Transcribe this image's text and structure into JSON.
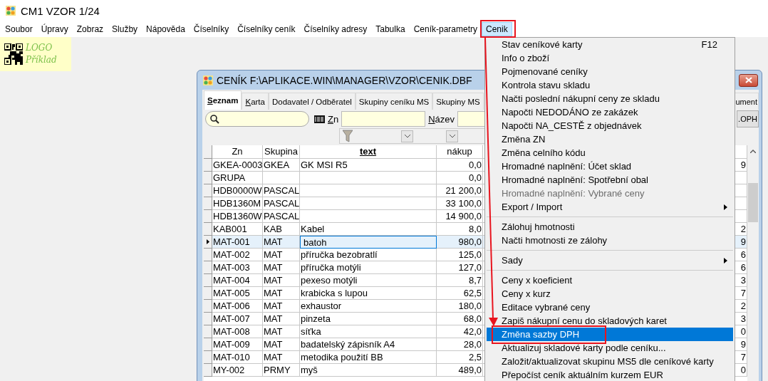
{
  "window": {
    "title": "CM1 VZOR 1/24"
  },
  "menubar": [
    {
      "label": "Soubor",
      "selected": false
    },
    {
      "label": "Úpravy",
      "selected": false
    },
    {
      "label": "Zobraz",
      "selected": false
    },
    {
      "label": "Služby",
      "selected": false
    },
    {
      "label": "Nápověda",
      "selected": false
    },
    {
      "label": "Číselníky",
      "selected": false
    },
    {
      "label": "Číselníky ceník",
      "selected": false
    },
    {
      "label": "Číselníky adresy",
      "selected": false
    },
    {
      "label": "Tabulka",
      "selected": false
    },
    {
      "label": "Ceník-parametry",
      "selected": false
    },
    {
      "label": "Cenik",
      "selected": true
    }
  ],
  "logo": {
    "line_1": "LOGO",
    "line_2": "Příklad"
  },
  "child_window": {
    "title": "CENÍK F:\\APLIKACE.WIN\\MANAGER\\VZOR\\CENIK.DBF",
    "tabs": [
      {
        "label": "Seznam",
        "selected": true,
        "mnemonic": true
      },
      {
        "label": "Karta",
        "selected": false,
        "mnemonic": true
      },
      {
        "label": "Dodavatel / Odběratel",
        "selected": false,
        "mnemonic": false
      },
      {
        "label": "Skupiny ceníku MS",
        "selected": false,
        "mnemonic": false
      },
      {
        "label": "Skupiny MS",
        "selected": false,
        "mnemonic": false
      },
      {
        "label": "ument",
        "selected": false,
        "mnemonic": false
      }
    ],
    "filters": [
      {
        "label": "Zn"
      },
      {
        "label": "Název"
      }
    ],
    "button": ".OPH",
    "table": {
      "columns": [
        {
          "label": "Zn",
          "sorted": false
        },
        {
          "label": "Skupina",
          "sorted": false
        },
        {
          "label": "text",
          "sorted": true
        },
        {
          "label": "nákup",
          "sorted": false
        }
      ],
      "rows": [
        {
          "zn": "GKEA-0003",
          "skupina": "GKEA",
          "text": "GK MSI R5",
          "nakup": "0,0",
          "column_5": "9",
          "selected": false
        },
        {
          "zn": "GRUPA",
          "nakup": "0,0",
          "selected": false
        },
        {
          "zn": "HDB0000W",
          "skupina": "PASCAL",
          "nakup": "21 200,0",
          "selected": false
        },
        {
          "zn": "HDB1360M",
          "skupina": "PASCAL",
          "nakup": "33 100,0",
          "selected": false
        },
        {
          "zn": "HDB1360W",
          "skupina": "PASCAL",
          "nakup": "14 900,0",
          "selected": false
        },
        {
          "zn": "KAB001",
          "skupina": "KAB",
          "text": "Kabel",
          "nakup": "8,0",
          "column_5": "2",
          "selected": false
        },
        {
          "zn": "MAT-001",
          "skupina": "MAT",
          "text": "batoh",
          "nakup": "980,0",
          "column_5": "9",
          "selected": true
        },
        {
          "zn": "MAT-002",
          "skupina": "MAT",
          "text": "příručka bezobratlí",
          "nakup": "125,0",
          "column_5": "6",
          "selected": false
        },
        {
          "zn": "MAT-003",
          "skupina": "MAT",
          "text": "příručka motýli",
          "nakup": "127,0",
          "column_5": "6",
          "selected": false
        },
        {
          "zn": "MAT-004",
          "skupina": "MAT",
          "text": "pexeso motýli",
          "nakup": "8,7",
          "column_5": "3",
          "selected": false
        },
        {
          "zn": "MAT-005",
          "skupina": "MAT",
          "text": "krabicka s lupou",
          "nakup": "62,5",
          "column_5": "7",
          "selected": false
        },
        {
          "zn": "MAT-006",
          "skupina": "MAT",
          "text": "exhaustor",
          "nakup": "180,0",
          "column_5": "2",
          "selected": false
        },
        {
          "zn": "MAT-007",
          "skupina": "MAT",
          "text": "pinzeta",
          "nakup": "68,0",
          "column_5": "3",
          "selected": false
        },
        {
          "zn": "MAT-008",
          "skupina": "MAT",
          "text": "síťka",
          "nakup": "42,0",
          "column_5": "0",
          "selected": false
        },
        {
          "zn": "MAT-009",
          "skupina": "MAT",
          "text": "badatelský zápisník A4",
          "nakup": "28,0",
          "column_5": "9",
          "selected": false
        },
        {
          "zn": "MAT-010",
          "skupina": "MAT",
          "text": "metodika použití BB",
          "nakup": "2,5",
          "column_5": "7",
          "selected": false
        },
        {
          "zn": "MY-002",
          "skupina": "PRMY",
          "text": "myš",
          "nakup": "489,0",
          "column_5": "0",
          "selected": false
        }
      ]
    }
  },
  "menu": {
    "items": [
      {
        "kind": "item",
        "label": "Stav ceníkové karty",
        "shortcut": "F12",
        "disabled": false,
        "selected": false
      },
      {
        "kind": "item",
        "label": "Info o zboží",
        "disabled": false,
        "selected": false
      },
      {
        "kind": "item",
        "label": "Pojmenované ceníky",
        "disabled": false,
        "selected": false
      },
      {
        "kind": "item",
        "label": "Kontrola stavu skladu",
        "disabled": false,
        "selected": false
      },
      {
        "kind": "item",
        "label": "Načti poslední nákupní ceny ze skladu",
        "disabled": false,
        "selected": false
      },
      {
        "kind": "item",
        "label": "Napočti NEDODÁNO ze zakázek",
        "disabled": false,
        "selected": false
      },
      {
        "kind": "item",
        "label": "Napočti NA_CESTĚ z objednávek",
        "disabled": false,
        "selected": false
      },
      {
        "kind": "item",
        "label": "Změna ZN",
        "disabled": false,
        "selected": false
      },
      {
        "kind": "item",
        "label": "Změna celního kódu",
        "disabled": false,
        "selected": false
      },
      {
        "kind": "item",
        "label": "Hromadné naplnění: Účet sklad",
        "disabled": false,
        "selected": false
      },
      {
        "kind": "item",
        "label": "Hromadné naplnění: Spotřební obal",
        "disabled": false,
        "selected": false
      },
      {
        "kind": "item",
        "label": "Hromadné naplnění: Vybrané ceny",
        "disabled": true,
        "selected": false
      },
      {
        "kind": "submenu",
        "label": "Export / Import",
        "disabled": false,
        "selected": false
      },
      {
        "kind": "separator"
      },
      {
        "kind": "item",
        "label": "Zálohuj hmotnosti",
        "disabled": false,
        "selected": false
      },
      {
        "kind": "item",
        "label": "Načti hmotnosti ze zálohy",
        "disabled": false,
        "selected": false
      },
      {
        "kind": "separator"
      },
      {
        "kind": "submenu",
        "label": "Sady",
        "disabled": false,
        "selected": false
      },
      {
        "kind": "separator"
      },
      {
        "kind": "item",
        "label": "Ceny x koeficient",
        "disabled": false,
        "selected": false
      },
      {
        "kind": "item",
        "label": "Ceny x kurz",
        "disabled": false,
        "selected": false
      },
      {
        "kind": "item",
        "label": "Editace vybrané ceny",
        "disabled": false,
        "selected": false
      },
      {
        "kind": "item",
        "label": "Zapiš nákupní cenu do skladových karet",
        "disabled": false,
        "selected": false
      },
      {
        "kind": "item",
        "label": "Změna sazby DPH",
        "disabled": false,
        "selected": true
      },
      {
        "kind": "item",
        "label": "Aktualizuj skladové karty podle ceníku...",
        "disabled": false,
        "selected": false
      },
      {
        "kind": "item",
        "label": "Založit/aktualizovat skupinu MS5 dle ceníkové karty",
        "disabled": false,
        "selected": false
      },
      {
        "kind": "item",
        "label": "Přepočíst ceník aktuálním kurzem EUR",
        "disabled": false,
        "selected": false
      }
    ]
  }
}
